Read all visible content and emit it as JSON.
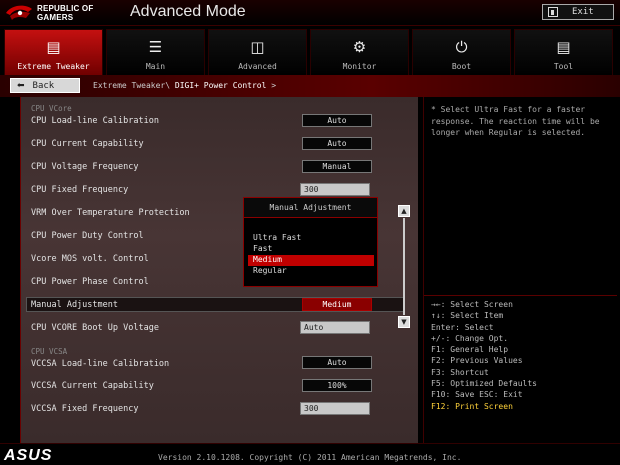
{
  "header": {
    "brand_line1": "REPUBLIC OF",
    "brand_line2": "GAMERS",
    "title": "Advanced Mode",
    "exit_label": "Exit"
  },
  "tabs": [
    {
      "label": "Extreme Tweaker",
      "icon": "tweaker-icon",
      "active": true
    },
    {
      "label": "Main",
      "icon": "list-icon",
      "active": false
    },
    {
      "label": "Advanced",
      "icon": "advanced-icon",
      "active": false
    },
    {
      "label": "Monitor",
      "icon": "monitor-icon",
      "active": false
    },
    {
      "label": "Boot",
      "icon": "power-icon",
      "active": false
    },
    {
      "label": "Tool",
      "icon": "tool-icon",
      "active": false
    }
  ],
  "breadcrumb": {
    "back_label": "Back",
    "path": "Extreme Tweaker\\",
    "current": "DIGI+ Power Control",
    "arrow": ">"
  },
  "settings": {
    "section_vcore": "CPU VCore",
    "items": [
      {
        "label": "CPU Load-line Calibration",
        "value": "Auto"
      },
      {
        "label": "CPU Current Capability",
        "value": "Auto"
      },
      {
        "label": "CPU Voltage Frequency",
        "value": "Manual"
      },
      {
        "label": "CPU Fixed Frequency",
        "value": "300"
      },
      {
        "label": "VRM Over Temperature Protection",
        "value": ""
      },
      {
        "label": "CPU Power Duty Control",
        "value": ""
      },
      {
        "label": "Vcore MOS volt. Control",
        "value": ""
      },
      {
        "label": "CPU Power Phase Control",
        "value": ""
      },
      {
        "label": "Manual Adjustment",
        "value": "Medium"
      },
      {
        "label": "CPU VCORE Boot Up Voltage",
        "value": "Auto"
      }
    ],
    "section_vcsa": "CPU VCSA",
    "vcsa_items": [
      {
        "label": "VCCSA Load-line Calibration",
        "value": "Auto"
      },
      {
        "label": "VCCSA Current Capability",
        "value": "100%"
      },
      {
        "label": "VCCSA Fixed Frequency",
        "value": "300"
      }
    ]
  },
  "popup": {
    "title": "Manual Adjustment",
    "options": [
      "Ultra Fast",
      "Fast",
      "Medium",
      "Regular"
    ],
    "selected": "Medium"
  },
  "help": {
    "description": "* Select Ultra Fast for a faster response. The reaction time will be longer when Regular is selected.",
    "keys": [
      "→←: Select Screen",
      "↑↓: Select Item",
      "Enter: Select",
      "+/-: Change Opt.",
      "F1: General Help",
      "F2: Previous Values",
      "F3: Shortcut",
      "F5: Optimized Defaults",
      "F10: Save  ESC: Exit"
    ],
    "highlight_key": "F12: Print Screen"
  },
  "footer": {
    "brand": "ASUS",
    "version": "Version 2.10.1208. Copyright (C) 2011 American Megatrends, Inc."
  },
  "colors": {
    "accent": "#c00000",
    "highlight_text": "#ffd23a"
  }
}
